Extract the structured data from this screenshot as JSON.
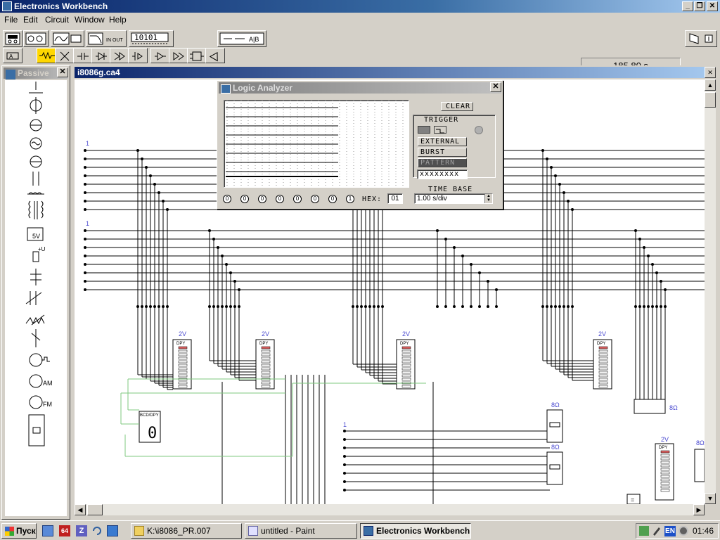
{
  "window": {
    "title": "Electronics Workbench"
  },
  "menu": [
    "File",
    "Edit",
    "Circuit",
    "Window",
    "Help"
  ],
  "toolbar": {
    "timer": "185.80 s",
    "word_gen_label": "10101",
    "inout_label": "IN OUT",
    "logic_conv_label": "A|B"
  },
  "palette": {
    "title": "Passive",
    "battery_label": "5V",
    "source_label": "+U",
    "am_label": "AM",
    "fm_label": "FM"
  },
  "circuit": {
    "title": "i8086g.ca4",
    "voltage_labels": [
      "2V",
      "2V",
      "2V",
      "2V",
      "2V"
    ],
    "resistor_labels": [
      "8Ω",
      "8Ω",
      "8Ω",
      "8Ω",
      "8Ω"
    ],
    "chip_label": "DPY",
    "decoder_label": "BCD/DPY",
    "decoder_digit": "0",
    "bus_marks": [
      "1",
      "1",
      "1"
    ],
    "equals_label": "="
  },
  "logic_analyzer": {
    "title": "Logic Analyzer",
    "clear": "CLEAR",
    "trigger": "TRIGGER",
    "external": "EXTERNAL",
    "burst": "BURST",
    "pattern": "PATTERN",
    "pattern_value": "xxxxxxxx",
    "hex_label": "HEX:",
    "hex_value": "01",
    "timebase_label": "TIME BASE",
    "timebase_value": "1.00 s/div",
    "channel_states": [
      "0",
      "0",
      "0",
      "0",
      "0",
      "0",
      "0",
      "1"
    ]
  },
  "taskbar": {
    "start": "Пуск",
    "tasks": [
      "K:\\i8086_PR.007",
      "untitled - Paint",
      "Electronics Workbench"
    ],
    "lang": "EN",
    "clock": "01:46"
  },
  "colors": {
    "title_active": "#0a246a",
    "title_inactive": "#808080",
    "wire": "#000000",
    "wire_green": "#7fc97f",
    "label_blue": "#4a4ad0"
  }
}
